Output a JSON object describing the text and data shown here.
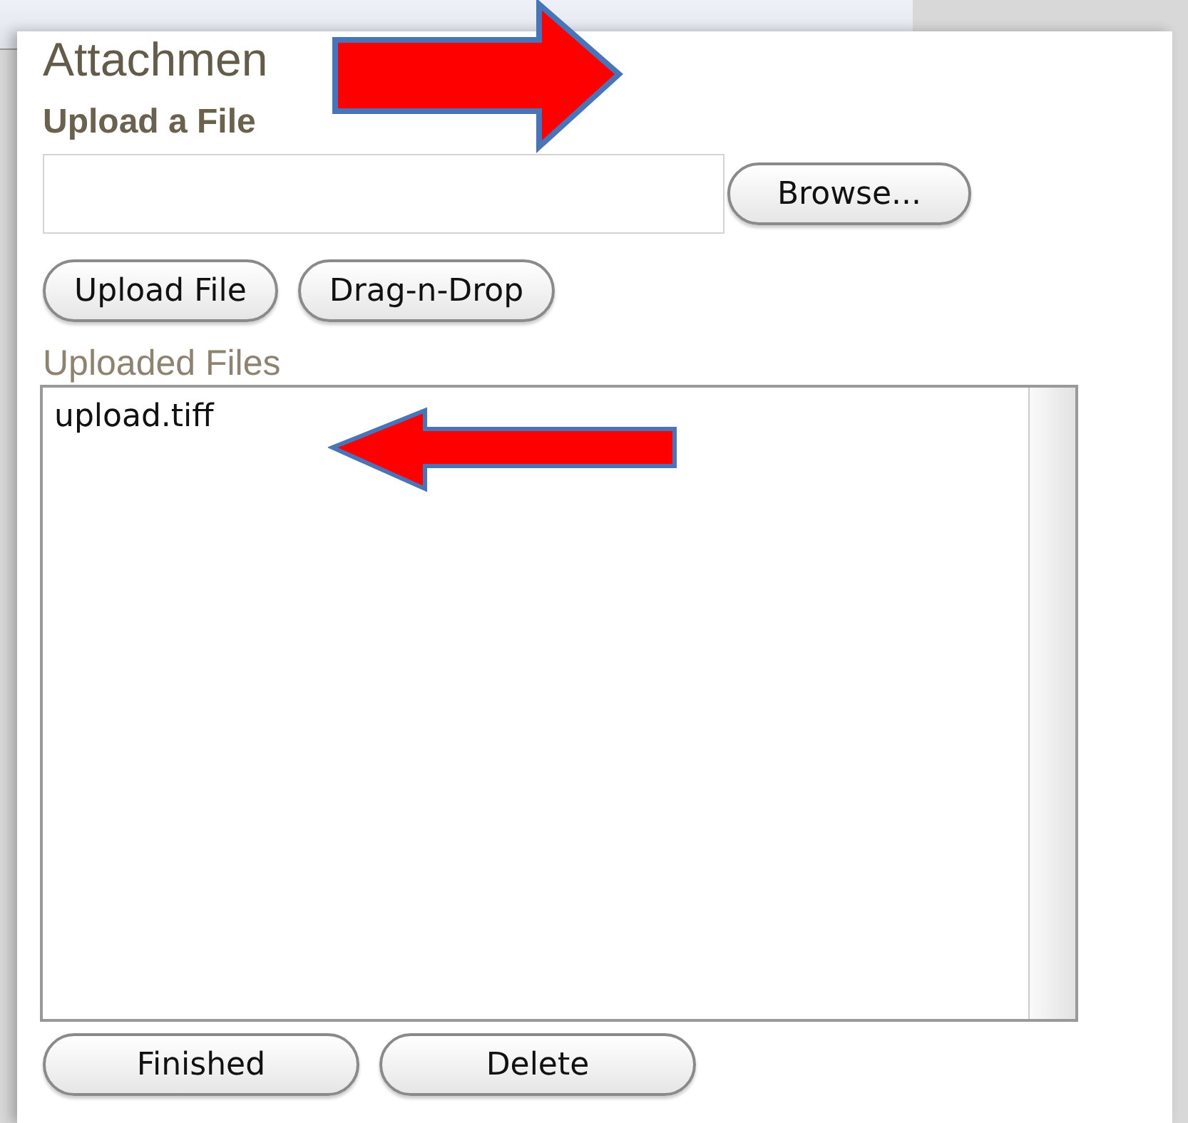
{
  "panel": {
    "title": "Attachmen"
  },
  "upload": {
    "heading": "Upload a File",
    "browse_button": "Browse...",
    "buttons": [
      "Upload File",
      "Drag-n-Drop"
    ]
  },
  "uploaded_files": {
    "label": "Uploaded Files",
    "files": [
      "upload.tiff"
    ]
  },
  "footer_buttons": [
    "Finished",
    "Delete"
  ]
}
